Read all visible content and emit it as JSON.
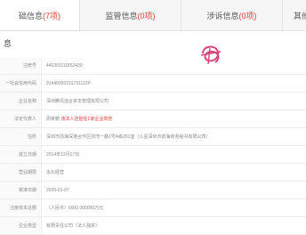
{
  "tabs": [
    {
      "name": "基础信息",
      "count": "(7项)",
      "display": "础信息(7项)",
      "active": true
    },
    {
      "name": "监管信息",
      "count": "(0项)",
      "display": "监管信息(0项)",
      "active": false
    },
    {
      "name": "涉诉信息",
      "count": "(0项)",
      "display": "涉诉信息(0项)",
      "active": false
    },
    {
      "name": "其他",
      "display": "其他信",
      "active": false
    }
  ],
  "section": {
    "title": "息"
  },
  "rows": [
    {
      "label": "注册号",
      "value": "440301111852439"
    },
    {
      "label": "一社会信用代码",
      "value": "91440300319731112P"
    },
    {
      "label": "企业名称",
      "value": "深圳腾讯迪合资本管理有限公司"
    },
    {
      "label": "法定代表人",
      "value": "周家鹏",
      "value_highlight": "该法人还担任1家企业高管"
    },
    {
      "label": "住所",
      "value": "深圳市前海深港合作区前湾一路1号A栋201室（入驻深圳市前海商务秘书有限公司）"
    },
    {
      "label": "成立日期",
      "value": "2014年12月17日"
    },
    {
      "label": "营业期限",
      "value": "永久经营"
    },
    {
      "label": "核准日期",
      "value": "2020-01-07"
    },
    {
      "label": "注册资本总额",
      "value": "（人民币）5000.000000万元"
    },
    {
      "label": "企业类型",
      "value": "有限责任公司（法人独资）"
    }
  ],
  "colors": {
    "accent_red": "#e03c31",
    "logo_pink": "#d9447a"
  },
  "icons": {
    "logo": "company-seal-logo-icon"
  }
}
